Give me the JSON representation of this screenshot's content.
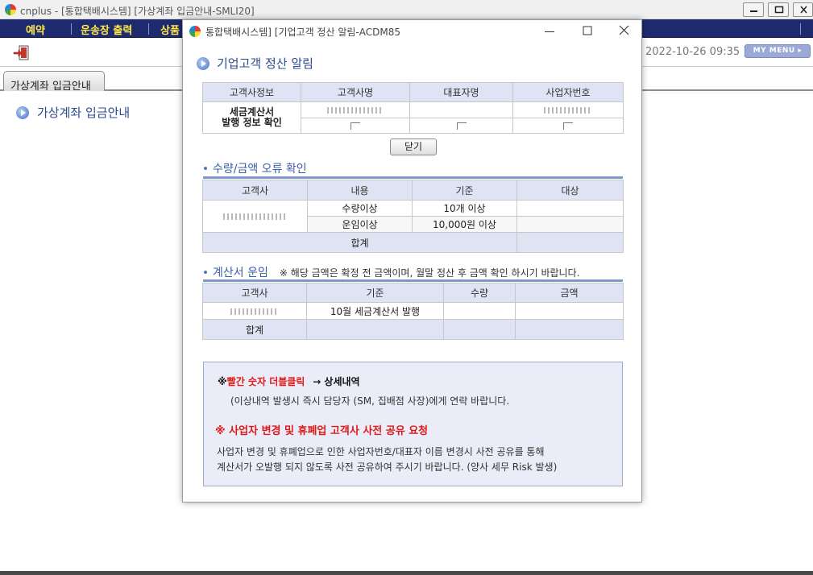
{
  "app": {
    "title": "cnplus - [통합택배시스템] [가상계좌 입금안내-SMLI20]",
    "menu": [
      "예약",
      "운송장 출력",
      "상품"
    ],
    "datetime": "2022-10-26 09:35 )",
    "my_menu_label": "MY MENU ▸",
    "tab_label": "가상계좌 입금안내",
    "page_heading": "가상계좌 입금안내"
  },
  "dialog": {
    "title": "통합택배시스템] [기업고객 정산 알림-ACDM85",
    "heading": "기업고객 정산 알림",
    "info_table": {
      "headers": [
        "고객사정보",
        "고객사명",
        "대표자명",
        "사업자번호"
      ],
      "row_label": "세금계산서\n발행 정보 확인"
    },
    "close_label": "닫기",
    "qty_section": {
      "title": "수량/금액 오류 확인",
      "headers": [
        "고객사",
        "내용",
        "기준",
        "대상"
      ],
      "rows": [
        {
          "content": "수량이상",
          "criteria": "10개 이상"
        },
        {
          "content": "운임이상",
          "criteria": "10,000원 이상"
        }
      ],
      "total_label": "합계"
    },
    "fee_section": {
      "title": "계산서 운임",
      "note": "※ 해당 금액은 확정 전 금액이며, 월말 정산 후 금액 확인 하시기 바랍니다.",
      "headers": [
        "고객사",
        "기준",
        "수량",
        "금액"
      ],
      "row_criteria": "10월 세금계산서 발행",
      "total_label": "합계"
    },
    "notice": {
      "line1_prefix": "※",
      "line1_red": "빨간 숫자 더블클릭",
      "line1_suffix": "→ 상세내역",
      "line2": "(이상내역 발생시 즉시 담당자 (SM, 집배점 사장)에게 연락 바랍니다.",
      "line3": "※ 사업자 변경 및 휴폐업 고객사 사전 공유 요청",
      "line4": "사업자 변경 및 휴폐업으로 인한 사업자번호/대표자 이름 변경시 사전 공유를 통해",
      "line5": "계산서가 오발행 되지 않도록 사전 공유하여 주시기 바랍니다. (양사 세무 Risk 발생)"
    }
  }
}
